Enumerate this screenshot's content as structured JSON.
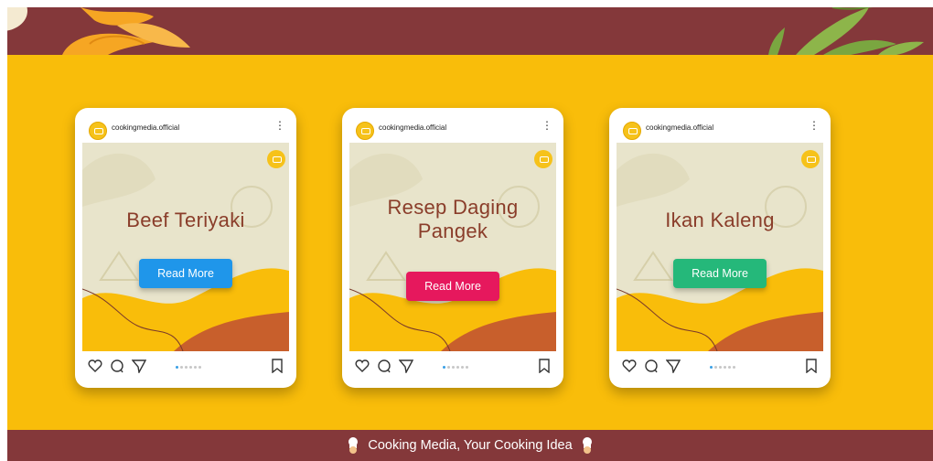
{
  "footer": {
    "tagline": "Cooking Media, Your Cooking Idea"
  },
  "cards": [
    {
      "username": "cookingmedia.official",
      "title_lines": [
        "Beef Teriyaki"
      ],
      "button": "Read More",
      "button_color": "#1f96ea"
    },
    {
      "username": "cookingmedia.official",
      "title_lines": [
        "Resep Daging",
        "Pangek"
      ],
      "button": "Read More",
      "button_color": "#e6185d"
    },
    {
      "username": "cookingmedia.official",
      "title_lines": [
        "Ikan Kaleng"
      ],
      "button": "Read More",
      "button_color": "#25b87a"
    }
  ],
  "colors": {
    "header": "#84383a",
    "background": "#f9bd0a",
    "post_bg": "#e8e4cb",
    "title": "#8a3d2a"
  },
  "icons": [
    "heart-icon",
    "comment-icon",
    "share-icon",
    "bookmark-icon",
    "more-vertical-icon",
    "chef-icon"
  ]
}
